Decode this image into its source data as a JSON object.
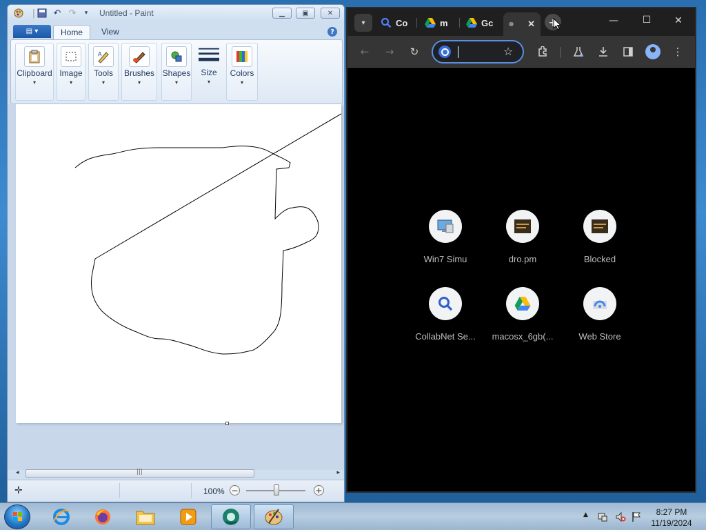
{
  "paint": {
    "title": "Untitled - Paint",
    "tabs": [
      "Home",
      "View"
    ],
    "groups": [
      {
        "label": "Clipboard"
      },
      {
        "label": "Image"
      },
      {
        "label": "Tools"
      },
      {
        "label": "Brushes"
      },
      {
        "label": "Shapes"
      },
      {
        "label": "Size"
      },
      {
        "label": "Colors"
      }
    ],
    "zoom": "100%"
  },
  "chrome": {
    "tabs": [
      {
        "label": "Co",
        "icon": "search-icon"
      },
      {
        "label": "m",
        "icon": "google-drive-icon"
      },
      {
        "label": "Gc",
        "icon": "google-drive-icon"
      },
      {
        "label": "",
        "icon": "globe-icon",
        "active": true
      }
    ],
    "new_tab": "+",
    "omnibox_value": "",
    "shortcuts": [
      {
        "label": "Win7 Simu",
        "icon": "computer-icon"
      },
      {
        "label": "dro.pm",
        "icon": "site-thumbnail-icon"
      },
      {
        "label": "Blocked",
        "icon": "site-thumbnail-icon"
      },
      {
        "label": "CollabNet Se...",
        "icon": "search-icon"
      },
      {
        "label": "macosx_6gb(...",
        "icon": "google-drive-icon"
      },
      {
        "label": "Web Store",
        "icon": "web-store-icon"
      }
    ]
  },
  "taskbar": {
    "clock_time": "8:27 PM",
    "clock_date": "11/19/2024"
  }
}
